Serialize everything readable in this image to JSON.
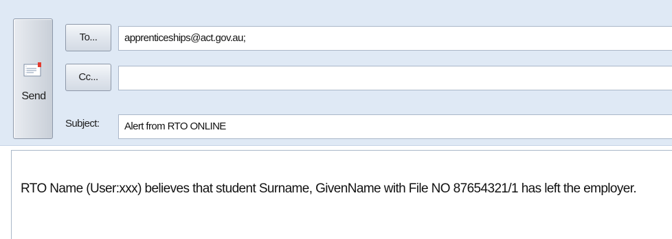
{
  "toolbar": {
    "send_label": "Send",
    "to_button_label": "To...",
    "cc_button_label": "Cc...",
    "subject_label": "Subject:"
  },
  "fields": {
    "to_value": "apprenticeships@act.gov.au;",
    "cc_value": "",
    "subject_value": "Alert from RTO ONLINE"
  },
  "message": {
    "body_text": "RTO Name (User:xxx) believes that student Surname, GivenName with File NO 87654321/1 has left the employer."
  },
  "icons": {
    "send": "send-mail-icon"
  },
  "colors": {
    "header_bg": "#dfe9f5",
    "border": "#a9b6c8",
    "icon_red": "#e23b2e"
  }
}
